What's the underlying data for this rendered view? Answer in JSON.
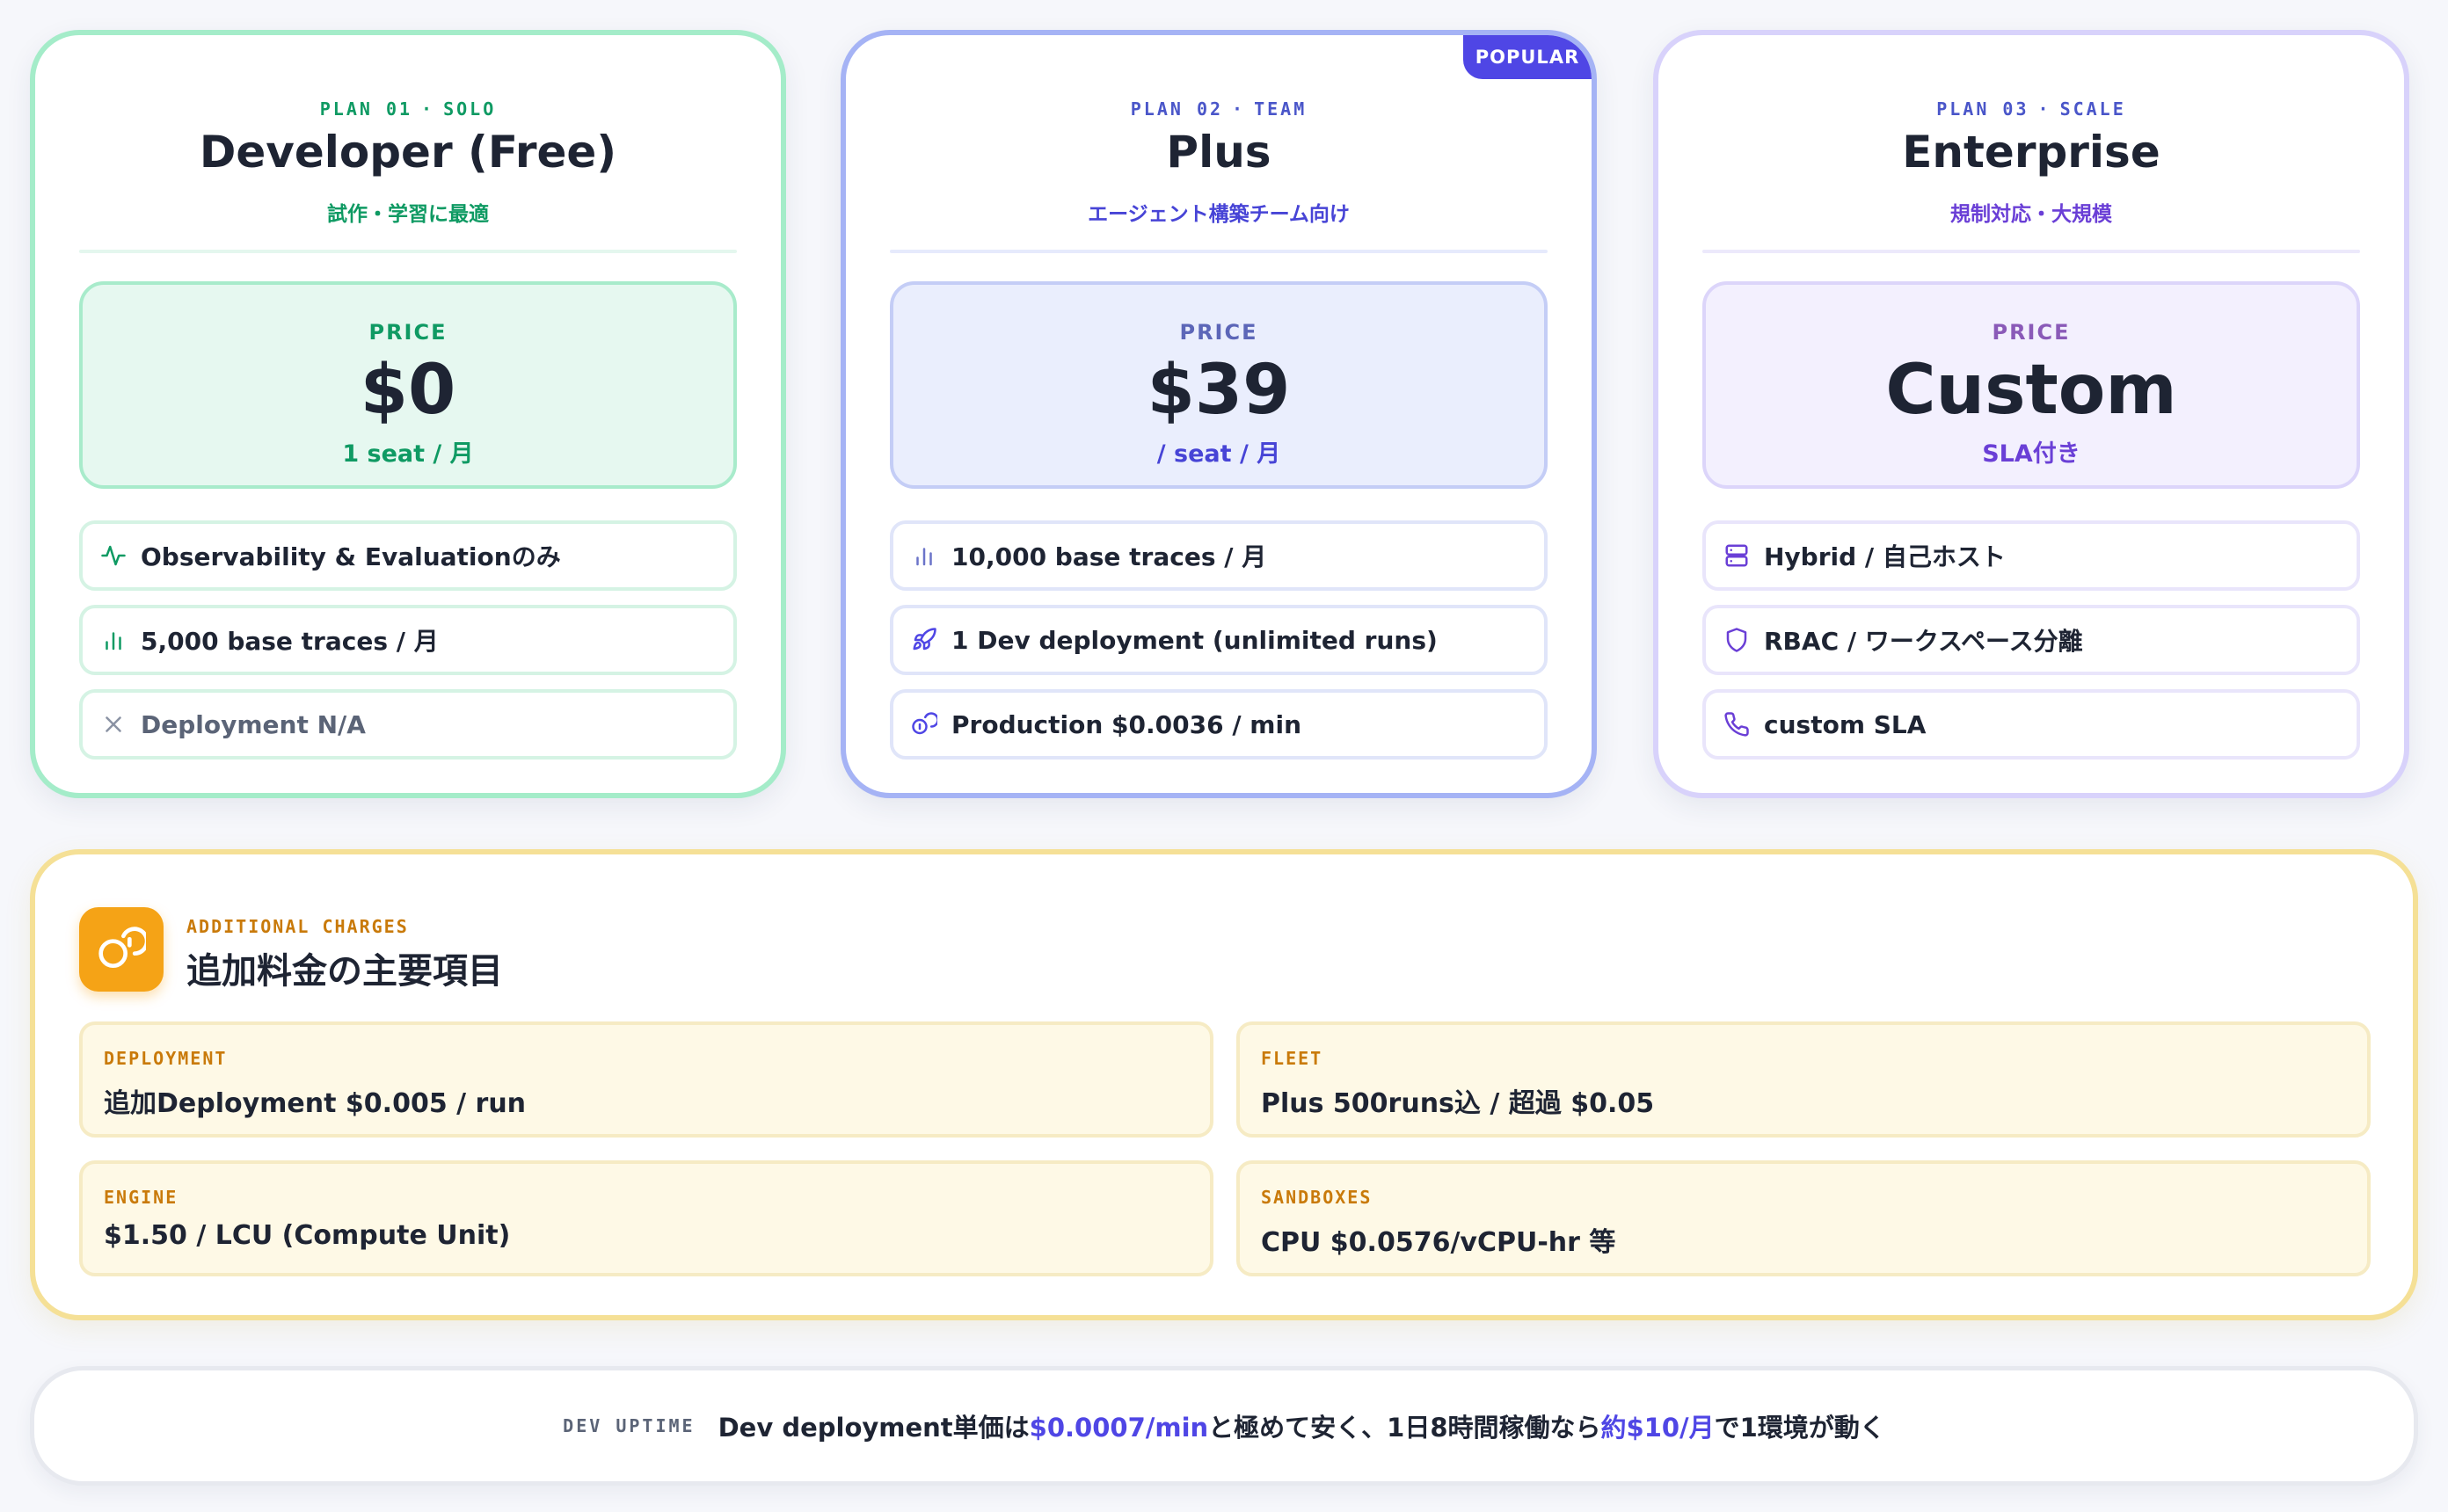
{
  "plans": [
    {
      "plan_no": "PLAN 01",
      "tier": "SOLO",
      "name": "Developer (Free)",
      "subtitle": "試作・学習に最適",
      "price_label": "PRICE",
      "price": "$0",
      "price_unit": "1 seat / 月",
      "features": [
        {
          "icon": "activity-icon",
          "text": "Observability & Evaluationのみ"
        },
        {
          "icon": "bar-chart-icon",
          "text": "5,000 base traces / 月"
        },
        {
          "icon": "x-icon",
          "text": "Deployment N/A"
        }
      ]
    },
    {
      "plan_no": "PLAN 02",
      "tier": "TEAM",
      "name": "Plus",
      "subtitle": "エージェント構築チーム向け",
      "badge": "POPULAR",
      "price_label": "PRICE",
      "price": "$39",
      "price_unit": "/ seat / 月",
      "features": [
        {
          "icon": "bar-chart-icon",
          "text": "10,000 base traces / 月"
        },
        {
          "icon": "rocket-icon",
          "text": "1 Dev deployment (unlimited runs)"
        },
        {
          "icon": "coins-icon",
          "text": "Production $0.0036 / min"
        }
      ]
    },
    {
      "plan_no": "PLAN 03",
      "tier": "SCALE",
      "name": "Enterprise",
      "subtitle": "規制対応・大規模",
      "price_label": "PRICE",
      "price": "Custom",
      "price_unit": "SLA付き",
      "features": [
        {
          "icon": "server-icon",
          "text": "Hybrid / 自己ホスト"
        },
        {
          "icon": "shield-icon",
          "text": "RBAC / ワークスペース分離"
        },
        {
          "icon": "phone-icon",
          "text": "custom SLA"
        }
      ]
    }
  ],
  "charges": {
    "kicker": "ADDITIONAL CHARGES",
    "title": "追加料金の主要項目",
    "icon": "coins-icon",
    "items": [
      {
        "label": "DEPLOYMENT",
        "value": "追加Deployment $0.005 / run"
      },
      {
        "label": "FLEET",
        "value": "Plus 500runs込 / 超過 $0.05"
      },
      {
        "label": "ENGINE",
        "value": "$1.50 / LCU (Compute Unit)"
      },
      {
        "label": "SANDBOXES",
        "value": "CPU $0.0576/vCPU-hr 等"
      }
    ]
  },
  "uptime": {
    "kicker": "DEV UPTIME",
    "msg_1": "Dev deployment単価は",
    "hl_1": "$0.0007/min",
    "msg_2": "と極めて安く、1日8時間稼働なら",
    "hl_2": "約$10/月",
    "msg_3": "で1環境が動く"
  },
  "colors": {
    "developer_accent": "#0f9a63",
    "plus_accent": "#4f46e5",
    "enterprise_accent": "#6a3fd6",
    "charges_accent": "#f5a316",
    "highlight": "#4f46e5"
  }
}
